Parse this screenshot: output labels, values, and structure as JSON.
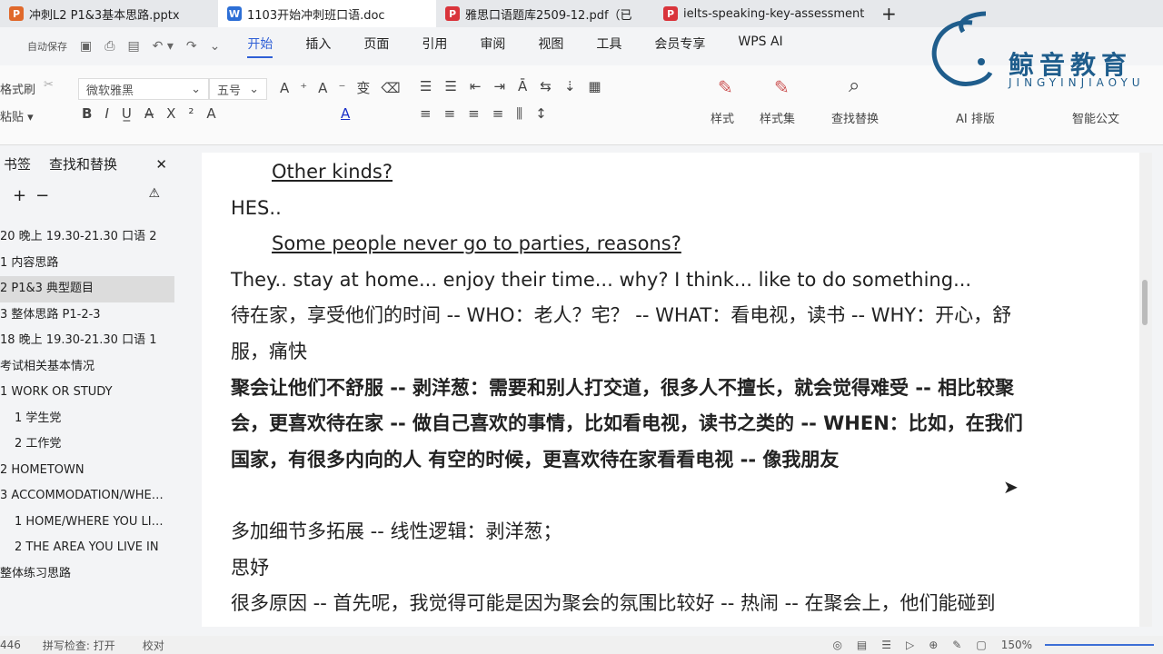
{
  "tabs": [
    {
      "label": "冲刺L2 P1&3基本思路.pptx",
      "icon": "P",
      "color": "#e0692b"
    },
    {
      "label": "1103开始冲刺班口语.doc",
      "icon": "W",
      "color": "#2d6fd6",
      "active": true
    },
    {
      "label": "雅思口语题库2509-12.pdf（已",
      "icon": "P",
      "color": "#d9343b"
    },
    {
      "label": "ielts-speaking-key-assessment",
      "icon": "P",
      "color": "#d9343b"
    }
  ],
  "quick": {
    "autosave": "自动保存"
  },
  "menu": [
    "开始",
    "插入",
    "页面",
    "引用",
    "审阅",
    "视图",
    "工具",
    "会员专享",
    "WPS AI"
  ],
  "ribbon": {
    "format_painter": "格式刷",
    "paste": "粘贴",
    "font": "微软雅黑",
    "size": "五号",
    "styles": "样式",
    "style_set": "样式集",
    "find_replace": "查找替换",
    "ai_layout": "AI 排版",
    "smart_doc": "智能公文"
  },
  "logo": {
    "cn": "鲸音教育",
    "en": "JINGYINJIAOYU"
  },
  "sidebar": {
    "tab1": "书签",
    "tab2": "查找和替换",
    "items": [
      "20 晚上 19.30-21.30 口语 2",
      "1 内容思路",
      "2 P1&3 典型题目",
      "3 整体思路 P1-2-3",
      "18 晚上 19.30-21.30 口语 1",
      "考试相关基本情况",
      "1 WORK OR STUDY",
      "1 学生党",
      "2 工作党",
      "2 HOMETOWN",
      "3 ACCOMMODATION/WHE…",
      "1 HOME/WHERE YOU LI…",
      "2 THE AREA YOU LIVE IN",
      "整体练习思路"
    ]
  },
  "doc": {
    "lines": [
      "Other kinds?",
      "HES..",
      "Some people never go to parties, reasons?",
      "They.. stay at home... enjoy their time... why? I think... like to do something...",
      "待在家，享受他们的时间 -- WHO：老人？宅？ -- WHAT：看电视，读书 -- WHY：开心，舒",
      "服，痛快",
      "聚会让他们不舒服 -- 剥洋葱：需要和别人打交道，很多人不擅长，就会觉得难受 -- 相比较聚",
      "会，更喜欢待在家 -- 做自己喜欢的事情，比如看电视，读书之类的 -- WHEN：比如，在我们",
      "国家，有很多内向的人 有空的时候，更喜欢待在家看看电视 -- 像我朋友",
      "",
      "多加细节多拓展 -- 线性逻辑：剥洋葱；",
      "思妤",
      "很多原因 -- 首先呢，我觉得可能是因为聚会的氛围比较好 -- 热闹 -- 在聚会上，他们能碰到"
    ]
  },
  "status": {
    "count": "446",
    "spell": "拼写检查: 打开",
    "proof": "校对",
    "zoom": "150%"
  }
}
